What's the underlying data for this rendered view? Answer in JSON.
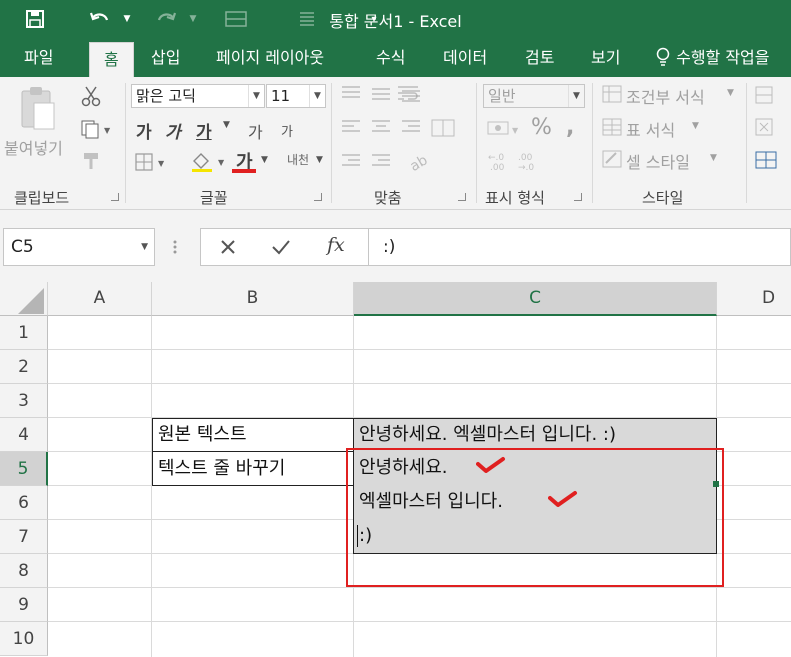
{
  "title_bar": {
    "title": "통합 문서1 - Excel"
  },
  "ribbon_tabs": [
    "파일",
    "홈",
    "삽입",
    "페이지 레이아웃",
    "수식",
    "데이터",
    "검토",
    "보기"
  ],
  "tell_me": "수행할 작업을",
  "clipboard": {
    "paste": "붙여넣기",
    "label": "클립보드"
  },
  "font": {
    "name": "맑은 고딕",
    "size": "11",
    "bold": "가",
    "italic": "가",
    "underline": "가",
    "grow": "가",
    "shrink": "가",
    "font_color": "가",
    "phonetic": "내천",
    "label": "글꼴"
  },
  "alignment": {
    "label": "맞춤"
  },
  "number": {
    "format": "일반",
    "percent": "%",
    "comma": ",",
    "label": "표시 형식"
  },
  "styles": {
    "conditional": "조건부 서식",
    "table": "표 서식",
    "cell": "셀 스타일",
    "label": "스타일"
  },
  "formula_bar": {
    "name_box": "C5",
    "fx": "fx",
    "value": ":)"
  },
  "columns": [
    "A",
    "B",
    "C",
    "D"
  ],
  "rows": [
    "1",
    "2",
    "3",
    "4",
    "5",
    "6",
    "7",
    "8",
    "9",
    "10"
  ],
  "cells": {
    "B4": "원본 텍스트",
    "C4": "안녕하세요. 엑셀마스터 입니다. :)",
    "B5": "텍스트 줄 바꾸기",
    "C5_line1": "안녕하세요.",
    "C5_line2": "엑셀마스터 입니다.",
    "C5_line3": ":)"
  },
  "colors": {
    "excel_green": "#217346",
    "highlight_red": "#e02020",
    "cell_fill": "#d9d9d9"
  }
}
